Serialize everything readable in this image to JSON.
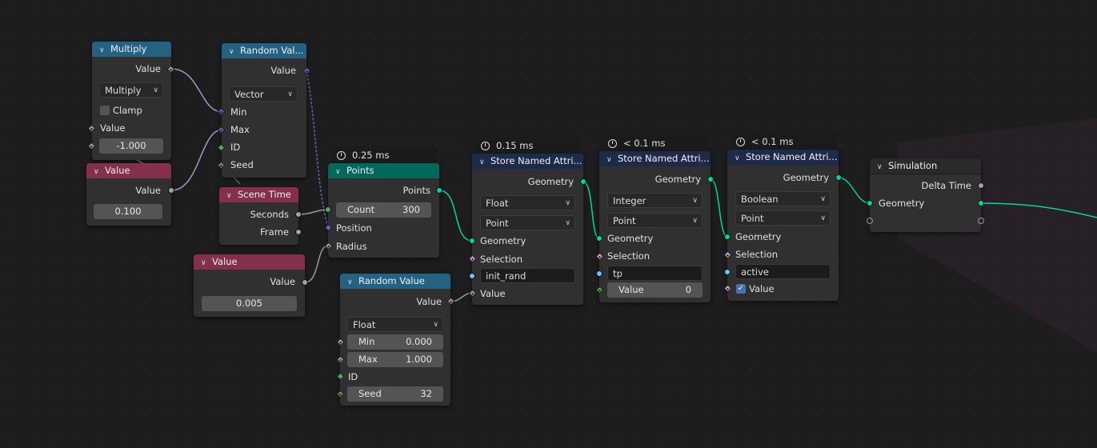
{
  "nodes": {
    "multiply": {
      "title": "Multiply",
      "output": "Value",
      "operation": "Multiply",
      "clamp_label": "Clamp",
      "input_label": "Value",
      "input_value": "-1.000"
    },
    "value_a": {
      "title": "Value",
      "output": "Value",
      "value": "0.100"
    },
    "random_vec": {
      "title": "Random Val...",
      "output": "Value",
      "type": "Vector",
      "inputs": [
        "Min",
        "Max",
        "ID",
        "Seed"
      ]
    },
    "scene_time": {
      "title": "Scene Time",
      "outputs": [
        "Seconds",
        "Frame"
      ]
    },
    "value_b": {
      "title": "Value",
      "output": "Value",
      "value": "0.005"
    },
    "points": {
      "timing": "0.25 ms",
      "title": "Points",
      "output": "Points",
      "count_label": "Count",
      "count_value": "300",
      "position_label": "Position",
      "radius_label": "Radius"
    },
    "random_float": {
      "title": "Random Value",
      "output": "Value",
      "type": "Float",
      "min_label": "Min",
      "min_value": "0.000",
      "max_label": "Max",
      "max_value": "1.000",
      "id_label": "ID",
      "seed_label": "Seed",
      "seed_value": "32"
    },
    "store1": {
      "timing": "0.15 ms",
      "title": "Store Named Attri...",
      "output": "Geometry",
      "data_type": "Float",
      "domain": "Point",
      "geometry_label": "Geometry",
      "selection_label": "Selection",
      "name": "init_rand",
      "value_label": "Value"
    },
    "store2": {
      "timing": "< 0.1 ms",
      "title": "Store Named Attri...",
      "output": "Geometry",
      "data_type": "Integer",
      "domain": "Point",
      "geometry_label": "Geometry",
      "selection_label": "Selection",
      "name": "tp",
      "value_label": "Value",
      "value": "0"
    },
    "store3": {
      "timing": "< 0.1 ms",
      "title": "Store Named Attri...",
      "output": "Geometry",
      "data_type": "Boolean",
      "domain": "Point",
      "geometry_label": "Geometry",
      "selection_label": "Selection",
      "name": "active",
      "value_label": "Value"
    },
    "simulation": {
      "title": "Simulation",
      "output": "Delta Time",
      "input": "Geometry"
    }
  },
  "colors": {
    "geometry_socket": "#00d6a3",
    "float_socket": "#a1a1a1",
    "vector_socket": "#6363c7",
    "integer_socket": "#59a659",
    "boolean_socket": "#cca6d6",
    "string_socket": "#63c7ff",
    "math_header": "#246283",
    "input_header": "#83314a",
    "geometry_header": "#00695a",
    "attribute_header": "#1e2a49"
  }
}
